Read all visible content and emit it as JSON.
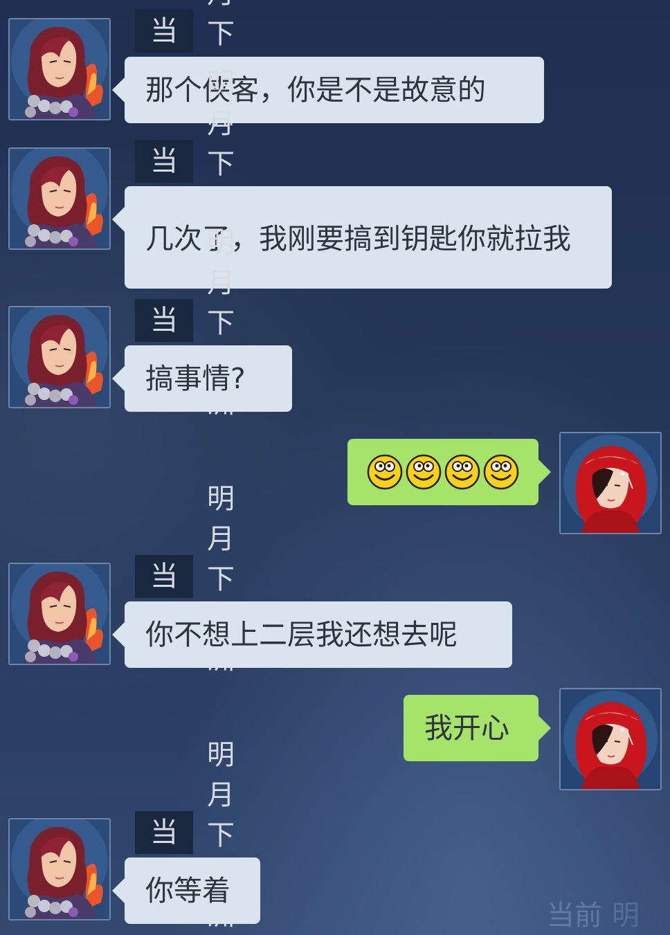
{
  "channel_label": "当前",
  "sender_name": "明月下南洲",
  "watermark": {
    "channel": "当前",
    "name": "明"
  },
  "icons": {
    "smiley": "smiley-emoji-icon"
  },
  "colors": {
    "incoming_bubble": "#dae4ee",
    "outgoing_bubble": "#a6e36a",
    "channel_tag_bg": "#19273f"
  },
  "messages": [
    {
      "direction": "incoming",
      "text": "那个侠客，你是不是故意的"
    },
    {
      "direction": "incoming",
      "text": "几次了，我刚要搞到钥匙你就拉我"
    },
    {
      "direction": "incoming",
      "text": "搞事情?"
    },
    {
      "direction": "outgoing",
      "emoji_count": 4
    },
    {
      "direction": "incoming",
      "text": "你不想上二层我还想去呢"
    },
    {
      "direction": "outgoing",
      "text": "我开心"
    },
    {
      "direction": "incoming",
      "text": "你等着"
    }
  ]
}
